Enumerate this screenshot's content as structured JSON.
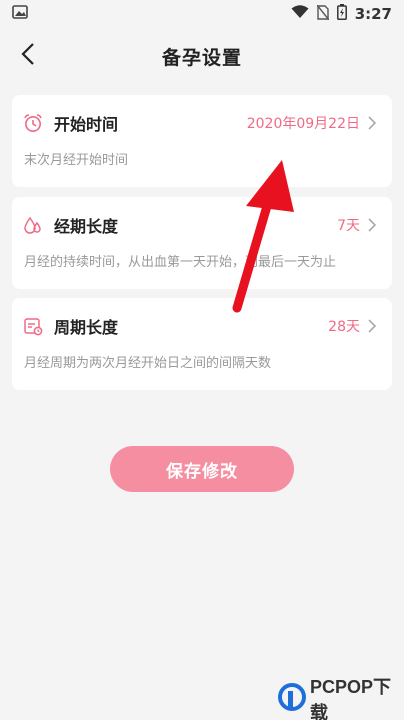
{
  "status_bar": {
    "time": "3:27"
  },
  "header": {
    "title": "备孕设置"
  },
  "settings": [
    {
      "label": "开始时间",
      "value": "2020年09月22日",
      "desc": "末次月经开始时间"
    },
    {
      "label": "经期长度",
      "value": "7天",
      "desc": "月经的持续时间，从出血第一天开始，到最后一天为止"
    },
    {
      "label": "周期长度",
      "value": "28天",
      "desc": "月经周期为两次月经开始日之间的间隔天数"
    }
  ],
  "save_button": {
    "label": "保存修改"
  },
  "watermark": {
    "brand": "PCPOP",
    "suffix": "下载"
  },
  "colors": {
    "accent": "#f06a86",
    "button": "#f58ea0",
    "arrow": "#e8111f"
  },
  "icons": [
    "image-icon",
    "wifi-icon",
    "no-sim-icon",
    "battery-icon",
    "back-icon",
    "alarm-clock-icon",
    "droplet-icon",
    "calendar-icon",
    "chevron-right-icon"
  ]
}
